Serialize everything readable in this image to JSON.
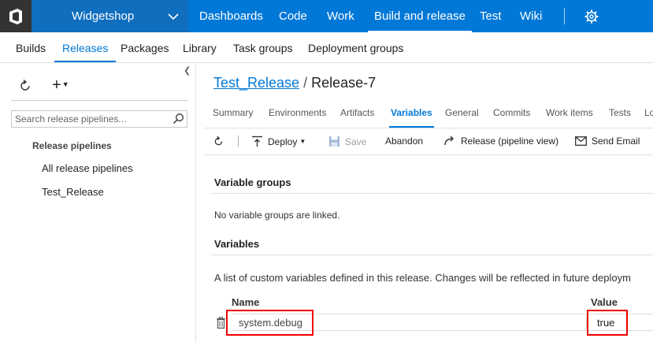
{
  "topbar": {
    "project": "Widgetshop",
    "nav": [
      "Dashboards",
      "Code",
      "Work",
      "Build and release",
      "Test",
      "Wiki"
    ],
    "active": "Build and release",
    "accent": "#0078d7"
  },
  "subnav": {
    "items": [
      "Builds",
      "Releases",
      "Packages",
      "Library",
      "Task groups",
      "Deployment groups"
    ],
    "active": "Releases"
  },
  "left": {
    "search_placeholder": "Search release pipelines...",
    "section_header": "Release pipelines",
    "items": [
      "All release pipelines",
      "Test_Release"
    ]
  },
  "main": {
    "breadcrumb": {
      "pipeline": "Test_Release",
      "separator": "/",
      "release": "Release-7"
    },
    "tabs": [
      "Summary",
      "Environments",
      "Artifacts",
      "Variables",
      "General",
      "Commits",
      "Work items",
      "Tests",
      "Lo"
    ],
    "active_tab": "Variables",
    "toolbar": {
      "deploy": "Deploy",
      "save": "Save",
      "abandon": "Abandon",
      "pipeline_view": "Release (pipeline view)",
      "send_email": "Send Email"
    },
    "variable_groups": {
      "title": "Variable groups",
      "note": "No variable groups are linked."
    },
    "variables": {
      "title": "Variables",
      "description": "A list of custom variables defined in this release. Changes will be reflected in future deploym",
      "col_name": "Name",
      "col_value": "Value",
      "rows": [
        {
          "name": "system.debug",
          "value": "true"
        }
      ]
    }
  },
  "colors": {
    "highlight": "#e00000",
    "brand": "#0078d7"
  }
}
